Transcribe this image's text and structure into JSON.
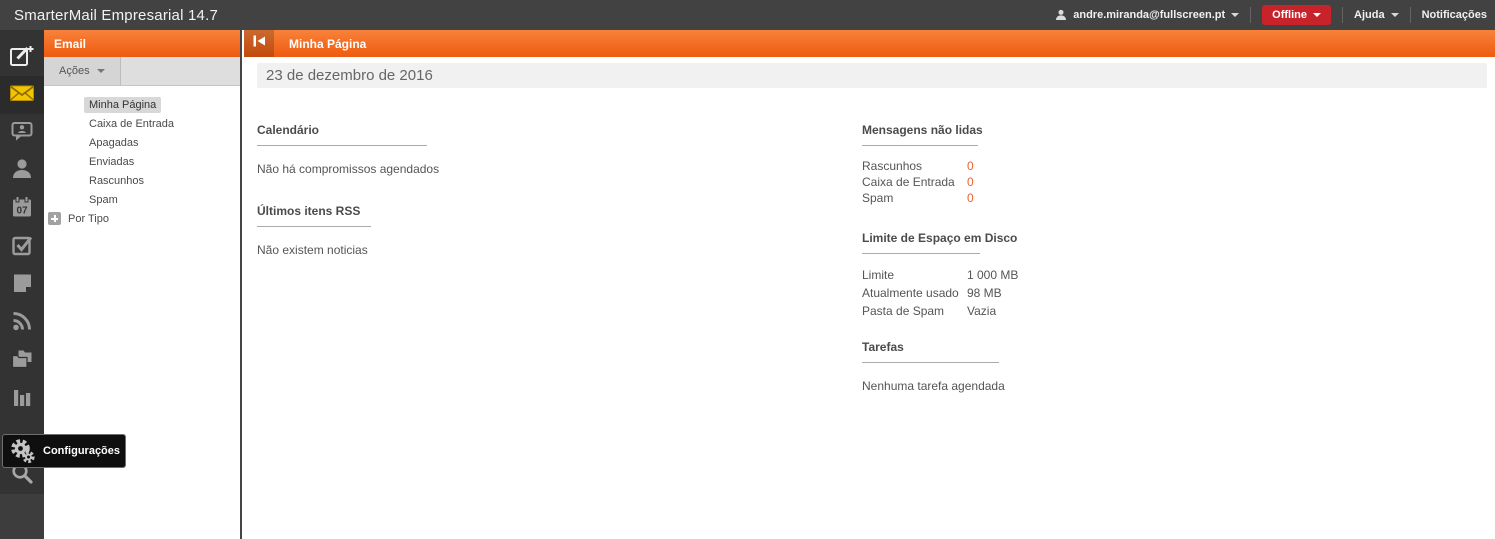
{
  "topbar": {
    "app_title": "SmarterMail Empresarial 14.7",
    "user_email": "andre.miranda@fullscreen.pt",
    "status_label": "Offline",
    "help_label": "Ajuda",
    "notifications_label": "Notificações",
    "status_color": "#c8232b",
    "accent_color": "#ee5a10"
  },
  "sidebar": {
    "calendar_day": "07",
    "tooltip_label": "Configurações",
    "active_item": "email",
    "icons": [
      "compose-icon",
      "email-icon",
      "chat-icon",
      "contacts-icon",
      "calendar-icon",
      "tasks-icon",
      "notes-icon",
      "rss-icon",
      "folders-icon",
      "reports-icon",
      "settings-icon",
      "search-icon"
    ]
  },
  "email_panel": {
    "title": "Email",
    "actions_label": "Ações",
    "selected_item": "Minha Página",
    "items": [
      "Minha Página",
      "Caixa de Entrada",
      "Apagadas",
      "Enviadas",
      "Rascunhos",
      "Spam",
      "Por Tipo"
    ]
  },
  "content": {
    "header_title": "Minha Página",
    "date_banner": "23 de dezembro de 2016",
    "calendar": {
      "title": "Calendário",
      "empty": "Não há compromissos agendados"
    },
    "rss": {
      "title": "Últimos itens RSS",
      "empty": "Não existem noticias"
    },
    "unread": {
      "title": "Mensagens não lidas",
      "value_color": "#e8622d",
      "rows": [
        {
          "label": "Rascunhos",
          "value": "0"
        },
        {
          "label": "Caixa de Entrada",
          "value": "0"
        },
        {
          "label": "Spam",
          "value": "0"
        }
      ]
    },
    "disk": {
      "title": "Limite de Espaço em Disco",
      "rows": [
        {
          "label": "Limite",
          "value": "1 000 MB"
        },
        {
          "label": "Atualmente usado",
          "value": "98 MB"
        },
        {
          "label": "Pasta de Spam",
          "value": "Vazia"
        }
      ]
    },
    "tasks": {
      "title": "Tarefas",
      "empty": "Nenhuma tarefa agendada"
    }
  }
}
